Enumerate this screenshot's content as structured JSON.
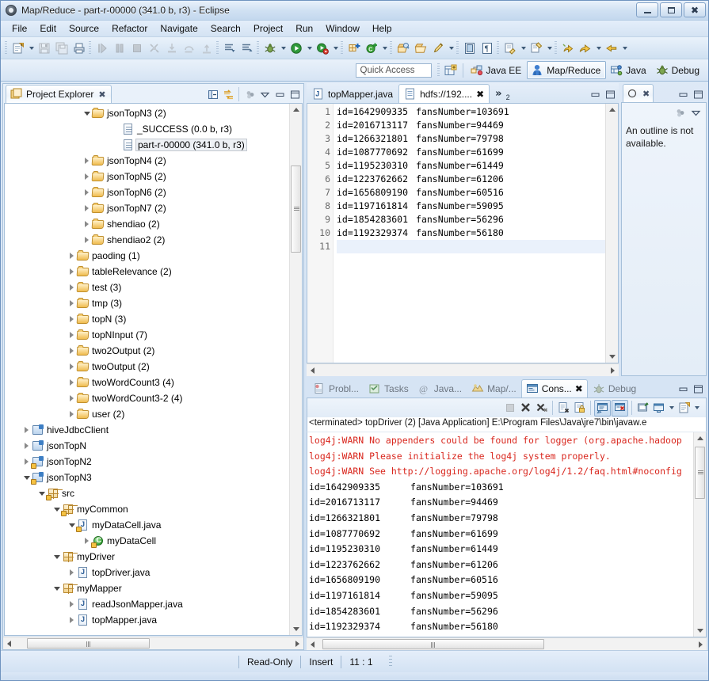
{
  "window": {
    "title": "Map/Reduce - part-r-00000 (341.0 b, r3) - Eclipse",
    "icon": "eclipse-icon",
    "buttons": {
      "minimize": "minimize-icon",
      "maximize": "maximize-icon",
      "close": "close-icon"
    }
  },
  "menubar": {
    "items": [
      "File",
      "Edit",
      "Source",
      "Refactor",
      "Navigate",
      "Search",
      "Project",
      "Run",
      "Window",
      "Help"
    ]
  },
  "toolbar": {
    "groups": [
      {
        "buttons": [
          {
            "name": "new-icon",
            "kind": "new"
          },
          {
            "name": "chevron-down-icon",
            "kind": "arrow"
          },
          {
            "name": "save-icon",
            "kind": "save",
            "dim": true
          },
          {
            "name": "save-all-icon",
            "kind": "saveall",
            "dim": true
          },
          {
            "name": "print-icon",
            "kind": "print"
          }
        ]
      },
      {
        "buttons": [
          {
            "name": "resume-icon",
            "kind": "resume",
            "dim": true
          },
          {
            "name": "suspend-icon",
            "kind": "suspend",
            "dim": true
          },
          {
            "name": "terminate-icon",
            "kind": "terminate",
            "dim": true
          },
          {
            "name": "disconnect-icon",
            "kind": "disconnect",
            "dim": true
          },
          {
            "name": "step-into-icon",
            "kind": "stepinto",
            "dim": true
          },
          {
            "name": "step-over-icon",
            "kind": "stepover",
            "dim": true
          },
          {
            "name": "step-return-icon",
            "kind": "stepreturn",
            "dim": true
          }
        ]
      },
      {
        "buttons": [
          {
            "name": "next-annotation-icon",
            "kind": "annot1"
          },
          {
            "name": "previous-annotation-icon",
            "kind": "annot2"
          }
        ]
      },
      {
        "buttons": [
          {
            "name": "debug-icon",
            "kind": "debug"
          },
          {
            "name": "chevron-down-icon",
            "kind": "arrow"
          },
          {
            "name": "run-icon",
            "kind": "run"
          },
          {
            "name": "chevron-down-icon",
            "kind": "arrow"
          },
          {
            "name": "run-external-tools-icon",
            "kind": "exttool"
          },
          {
            "name": "chevron-down-icon",
            "kind": "arrow"
          }
        ]
      },
      {
        "buttons": [
          {
            "name": "new-java-package-icon",
            "kind": "newpkg"
          },
          {
            "name": "new-java-class-icon",
            "kind": "newclass"
          },
          {
            "name": "chevron-down-icon",
            "kind": "arrow"
          }
        ]
      },
      {
        "buttons": [
          {
            "name": "open-type-icon",
            "kind": "opentype"
          },
          {
            "name": "open-task-icon",
            "kind": "opentask"
          },
          {
            "name": "search-icon",
            "kind": "searchpen"
          },
          {
            "name": "chevron-down-icon",
            "kind": "arrow"
          }
        ]
      },
      {
        "buttons": [
          {
            "name": "toggle-block-selection-icon",
            "kind": "blocksel"
          },
          {
            "name": "show-whitespace-icon",
            "kind": "whitespace"
          }
        ]
      },
      {
        "buttons": [
          {
            "name": "next-edit-icon",
            "kind": "nextedit"
          },
          {
            "name": "chevron-down-icon",
            "kind": "arrow"
          },
          {
            "name": "previous-edit-icon",
            "kind": "prevedit"
          },
          {
            "name": "chevron-down-icon",
            "kind": "arrow"
          }
        ]
      },
      {
        "buttons": [
          {
            "name": "back-history-icon",
            "kind": "backy"
          },
          {
            "name": "back-icon",
            "kind": "back"
          },
          {
            "name": "chevron-down-icon",
            "kind": "arrow"
          },
          {
            "name": "forward-icon",
            "kind": "forward"
          },
          {
            "name": "chevron-down-icon",
            "kind": "arrow"
          }
        ]
      }
    ]
  },
  "quick_access": {
    "placeholder": "Quick Access",
    "value": ""
  },
  "perspectives": {
    "open_button": "open-perspective-icon",
    "items": [
      {
        "label": "Java EE",
        "icon": "java-ee-icon",
        "active": false
      },
      {
        "label": "Map/Reduce",
        "icon": "map-reduce-icon",
        "active": true
      },
      {
        "label": "Java",
        "icon": "java-icon",
        "active": false
      },
      {
        "label": "Debug",
        "icon": "debug-perspective-icon",
        "active": false
      }
    ]
  },
  "project_explorer": {
    "tab_label": "Project Explorer",
    "tab_icon": "project-explorer-icon",
    "tools": [
      {
        "name": "collapse-all-icon"
      },
      {
        "name": "link-with-editor-icon"
      },
      {
        "name": "focus-on-active-task-icon"
      },
      {
        "name": "view-menu-icon"
      },
      {
        "name": "minimize-icon"
      },
      {
        "name": "maximize-icon"
      }
    ],
    "tree": [
      {
        "indent": 5,
        "twist": "open",
        "icon": "folder-open",
        "label": "jsonTopN3 (2)"
      },
      {
        "indent": 7,
        "twist": "none",
        "icon": "file",
        "label": "_SUCCESS (0.0 b, r3)"
      },
      {
        "indent": 7,
        "twist": "none",
        "icon": "file",
        "label": "part-r-00000 (341.0 b, r3)",
        "selected": true
      },
      {
        "indent": 5,
        "twist": "closed",
        "icon": "folder-open",
        "label": "jsonTopN4 (2)"
      },
      {
        "indent": 5,
        "twist": "closed",
        "icon": "folder-open",
        "label": "jsonTopN5 (2)"
      },
      {
        "indent": 5,
        "twist": "closed",
        "icon": "folder-open",
        "label": "jsonTopN6 (2)"
      },
      {
        "indent": 5,
        "twist": "closed",
        "icon": "folder-open",
        "label": "jsonTopN7 (2)"
      },
      {
        "indent": 5,
        "twist": "closed",
        "icon": "folder-open",
        "label": "shendiao (2)"
      },
      {
        "indent": 5,
        "twist": "closed",
        "icon": "folder-open",
        "label": "shendiao2 (2)"
      },
      {
        "indent": 4,
        "twist": "closed",
        "icon": "folder-open",
        "label": "paoding (1)"
      },
      {
        "indent": 4,
        "twist": "closed",
        "icon": "folder-open",
        "label": "tableRelevance (2)"
      },
      {
        "indent": 4,
        "twist": "closed",
        "icon": "folder-open",
        "label": "test (3)"
      },
      {
        "indent": 4,
        "twist": "closed",
        "icon": "folder-open",
        "label": "tmp (3)"
      },
      {
        "indent": 4,
        "twist": "closed",
        "icon": "folder-open",
        "label": "topN (3)"
      },
      {
        "indent": 4,
        "twist": "closed",
        "icon": "folder-open",
        "label": "topNInput (7)"
      },
      {
        "indent": 4,
        "twist": "closed",
        "icon": "folder-open",
        "label": "two2Output (2)"
      },
      {
        "indent": 4,
        "twist": "closed",
        "icon": "folder-open",
        "label": "twoOutput (2)"
      },
      {
        "indent": 4,
        "twist": "closed",
        "icon": "folder-open",
        "label": "twoWordCount3 (4)"
      },
      {
        "indent": 4,
        "twist": "closed",
        "icon": "folder-open",
        "label": "twoWordCount3-2 (4)"
      },
      {
        "indent": 4,
        "twist": "closed",
        "icon": "folder-open",
        "label": "user (2)"
      },
      {
        "indent": 1,
        "twist": "closed",
        "icon": "jproject",
        "label": "hiveJdbcClient"
      },
      {
        "indent": 1,
        "twist": "closed",
        "icon": "jproject",
        "label": "jsonTopN"
      },
      {
        "indent": 1,
        "twist": "closed",
        "icon": "jproject-lock",
        "label": "jsonTopN2"
      },
      {
        "indent": 1,
        "twist": "open",
        "icon": "jproject-lock",
        "label": "jsonTopN3"
      },
      {
        "indent": 2,
        "twist": "open",
        "icon": "srcfolder",
        "label": "src"
      },
      {
        "indent": 3,
        "twist": "open",
        "icon": "package-lock",
        "label": "myCommon"
      },
      {
        "indent": 4,
        "twist": "open",
        "icon": "javafile-lock",
        "label": "myDataCell.java"
      },
      {
        "indent": 5,
        "twist": "closed",
        "icon": "class-lock",
        "label": "myDataCell"
      },
      {
        "indent": 3,
        "twist": "open",
        "icon": "package",
        "label": "myDriver"
      },
      {
        "indent": 4,
        "twist": "closed",
        "icon": "javafile",
        "label": "topDriver.java"
      },
      {
        "indent": 3,
        "twist": "open",
        "icon": "package",
        "label": "myMapper"
      },
      {
        "indent": 4,
        "twist": "closed",
        "icon": "javafile",
        "label": "readJsonMapper.java"
      },
      {
        "indent": 4,
        "twist": "closed",
        "icon": "javafile",
        "label": "topMapper.java"
      }
    ]
  },
  "editor": {
    "tabs": [
      {
        "label": "topMapper.java",
        "icon": "java-file-icon",
        "selected": false,
        "closable": false
      },
      {
        "label": "hdfs://192....",
        "icon": "text-file-icon",
        "selected": true,
        "closable": true
      }
    ],
    "chevron": {
      "glyph": "»",
      "count": "2"
    },
    "tools": [
      {
        "name": "minimize-icon"
      },
      {
        "name": "maximize-icon"
      }
    ],
    "line_numbers": [
      "1",
      "2",
      "3",
      "4",
      "5",
      "6",
      "7",
      "8",
      "9",
      "10",
      "11"
    ],
    "lines": [
      {
        "id": "id=1642909335",
        "fans": "fansNumber=103691"
      },
      {
        "id": "id=2016713117",
        "fans": "fansNumber=94469"
      },
      {
        "id": "id=1266321801",
        "fans": "fansNumber=79798"
      },
      {
        "id": "id=1087770692",
        "fans": "fansNumber=61699"
      },
      {
        "id": "id=1195230310",
        "fans": "fansNumber=61449"
      },
      {
        "id": "id=1223762662",
        "fans": "fansNumber=61206"
      },
      {
        "id": "id=1656809190",
        "fans": "fansNumber=60516"
      },
      {
        "id": "id=1197161814",
        "fans": "fansNumber=59095"
      },
      {
        "id": "id=1854283601",
        "fans": "fansNumber=56296"
      },
      {
        "id": "id=1192329374",
        "fans": "fansNumber=56180"
      },
      {
        "id": "",
        "fans": ""
      }
    ]
  },
  "outline": {
    "tab_label": "",
    "tab_icon": "outline-icon",
    "close_icon": "close-icon",
    "tools": [
      {
        "name": "minimize-icon"
      },
      {
        "name": "maximize-icon"
      }
    ],
    "body_tools": [
      {
        "name": "focus-icon"
      },
      {
        "name": "view-menu-icon"
      }
    ],
    "message": "An outline is not available."
  },
  "console": {
    "tabs": [
      {
        "label": "Probl...",
        "icon": "problems-icon",
        "selected": false
      },
      {
        "label": "Tasks",
        "icon": "tasks-icon",
        "selected": false
      },
      {
        "label": "Java...",
        "icon": "javadoc-icon",
        "selected": false
      },
      {
        "label": "Map/...",
        "icon": "map-reduce-locations-icon",
        "selected": false
      },
      {
        "label": "Cons...",
        "icon": "console-icon",
        "selected": true,
        "closable": true
      },
      {
        "label": "Debug",
        "icon": "debug-view-icon",
        "selected": false
      }
    ],
    "panel_tools": [
      {
        "name": "minimize-icon"
      },
      {
        "name": "maximize-icon"
      }
    ],
    "toolbar": [
      {
        "name": "terminate-icon",
        "kind": "stop",
        "dim": true
      },
      {
        "name": "remove-launch-icon",
        "kind": "x1"
      },
      {
        "name": "remove-all-terminated-icon",
        "kind": "x2"
      },
      {
        "name": "clear-console-icon",
        "kind": "clear"
      },
      {
        "name": "scroll-lock-icon",
        "kind": "lock"
      },
      {
        "name": "show-console-on-output-icon",
        "kind": "showout",
        "pressed": true
      },
      {
        "name": "show-console-on-error-icon",
        "kind": "showerr",
        "pressed": true
      },
      {
        "name": "pin-console-icon",
        "kind": "pin"
      },
      {
        "name": "display-selected-console-icon",
        "kind": "display"
      },
      {
        "name": "chevron-down-icon",
        "kind": "arrow"
      },
      {
        "name": "open-console-icon",
        "kind": "opencon"
      },
      {
        "name": "chevron-down-icon",
        "kind": "arrow"
      }
    ],
    "header": "<terminated> topDriver (2) [Java Application] E:\\Program Files\\Java\\jre7\\bin\\javaw.e",
    "lines": [
      {
        "text": "log4j:WARN No appenders could be found for logger (org.apache.hadoop",
        "warn": true
      },
      {
        "text": "log4j:WARN Please initialize the log4j system properly.",
        "warn": true
      },
      {
        "text": "log4j:WARN See http://logging.apache.org/log4j/1.2/faq.html#noconfig",
        "warn": true
      },
      {
        "id": "id=1642909335",
        "fans": "fansNumber=103691"
      },
      {
        "id": "id=2016713117",
        "fans": "fansNumber=94469"
      },
      {
        "id": "id=1266321801",
        "fans": "fansNumber=79798"
      },
      {
        "id": "id=1087770692",
        "fans": "fansNumber=61699"
      },
      {
        "id": "id=1195230310",
        "fans": "fansNumber=61449"
      },
      {
        "id": "id=1223762662",
        "fans": "fansNumber=61206"
      },
      {
        "id": "id=1656809190",
        "fans": "fansNumber=60516"
      },
      {
        "id": "id=1197161814",
        "fans": "fansNumber=59095"
      },
      {
        "id": "id=1854283601",
        "fans": "fansNumber=56296"
      },
      {
        "id": "id=1192329374",
        "fans": "fansNumber=56180"
      }
    ]
  },
  "statusbar": {
    "read_only": "Read-Only",
    "insert_mode": "Insert",
    "position": "11 : 1"
  },
  "colors": {
    "accent": "#3d7ec4",
    "warn_text": "#d9271e",
    "folder": "#f6c85f",
    "chrome": "#d6e2f0",
    "selection": "#eef1f5"
  }
}
